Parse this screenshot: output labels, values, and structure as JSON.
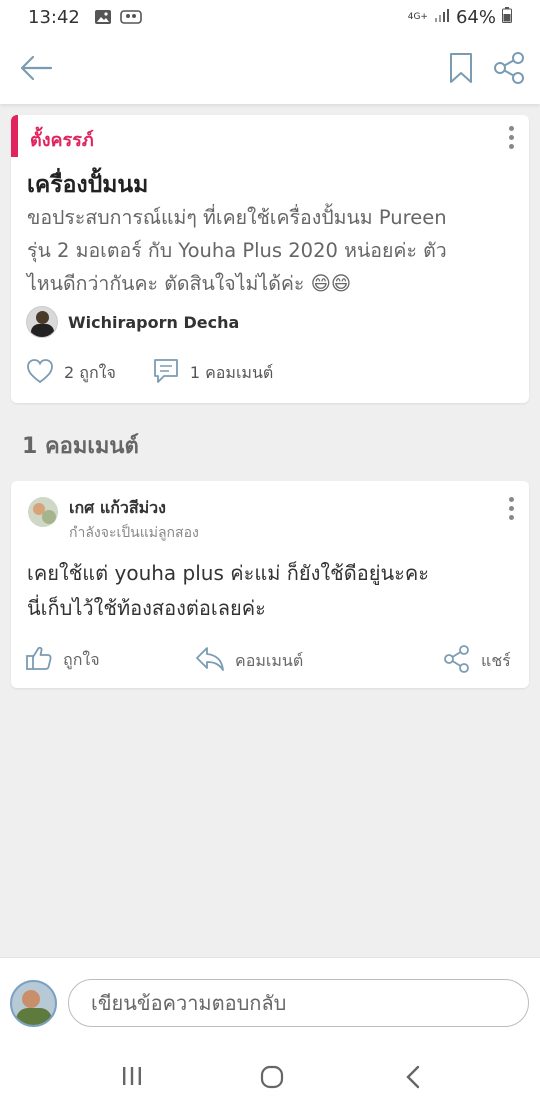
{
  "status_bar": {
    "time": "13:42",
    "network": "4G+",
    "battery": "64%"
  },
  "post": {
    "tag": "ตั้งครรภ์",
    "title": "เครื่องปั้มนม",
    "body_line1": "ขอประสบการณ์แม่ๆ ที่เคยใช้เครื่องปั้มนม Pureen",
    "body_line2": "รุ่น 2 มอเตอร์ กับ Youha Plus 2020 หน่อยค่ะ ตัว",
    "body_line3": "ไหนดีกว่ากันคะ ตัดสินใจไม่ได้ค่ะ 😄😄",
    "author": "Wichiraporn Decha",
    "likes": "2 ถูกใจ",
    "comments": "1 คอมเมนต์"
  },
  "comment_section": {
    "count_label": "1 คอมเมนต์"
  },
  "comment": {
    "name": "เกศ แก้วสีม่วง",
    "subtitle": "กำลังจะเป็นแม่ลูกสอง",
    "body_line1": "เคยใช้แต่ youha plus ค่ะแม่ ก็ยังใช้ดีอยู่นะคะ",
    "body_line2": "นี่เก็บไว้ใช้ท้องสองต่อเลยค่ะ",
    "like_label": "ถูกใจ",
    "reply_label": "คอมเมนต์",
    "share_label": "แชร์"
  },
  "reply_bar": {
    "placeholder": "เขียนข้อความตอบกลับ"
  },
  "colors": {
    "accent": "#e0245e",
    "icon": "#7a9cb3"
  }
}
